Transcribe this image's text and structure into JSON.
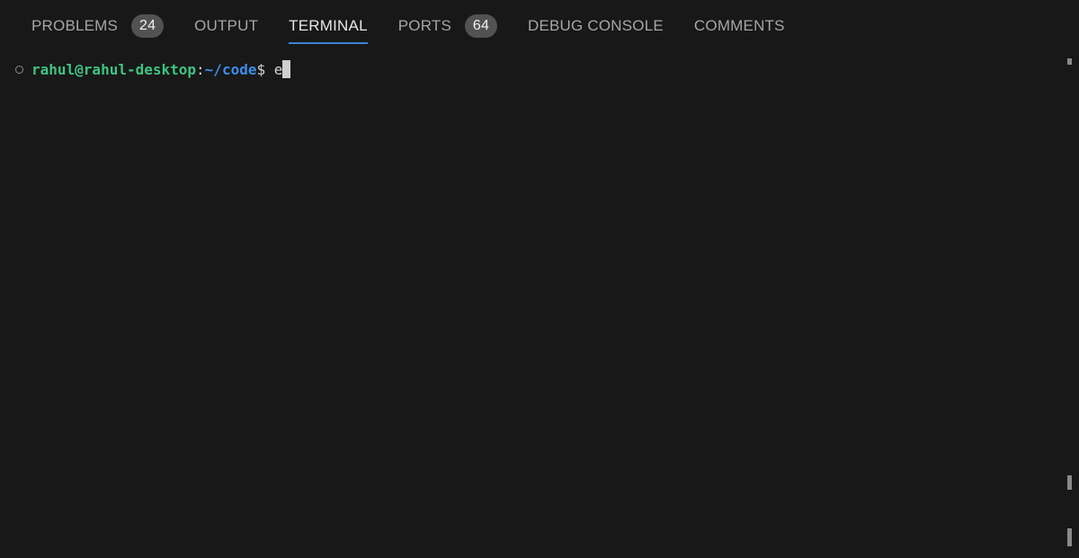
{
  "tabs": [
    {
      "label": "PROBLEMS",
      "badge": "24",
      "active": false
    },
    {
      "label": "OUTPUT",
      "badge": null,
      "active": false
    },
    {
      "label": "TERMINAL",
      "badge": null,
      "active": true
    },
    {
      "label": "PORTS",
      "badge": "64",
      "active": false
    },
    {
      "label": "DEBUG CONSOLE",
      "badge": null,
      "active": false
    },
    {
      "label": "COMMENTS",
      "badge": null,
      "active": false
    }
  ],
  "terminal": {
    "prompt_userhost": "rahul@rahul-desktop",
    "prompt_colon": ":",
    "prompt_cwd": "~/code",
    "prompt_symbol": "$ ",
    "typed_input": "e"
  },
  "colors": {
    "accent": "#3b82d6",
    "userhost": "#3fc380",
    "cwd": "#3c8de8",
    "background": "#181818"
  }
}
